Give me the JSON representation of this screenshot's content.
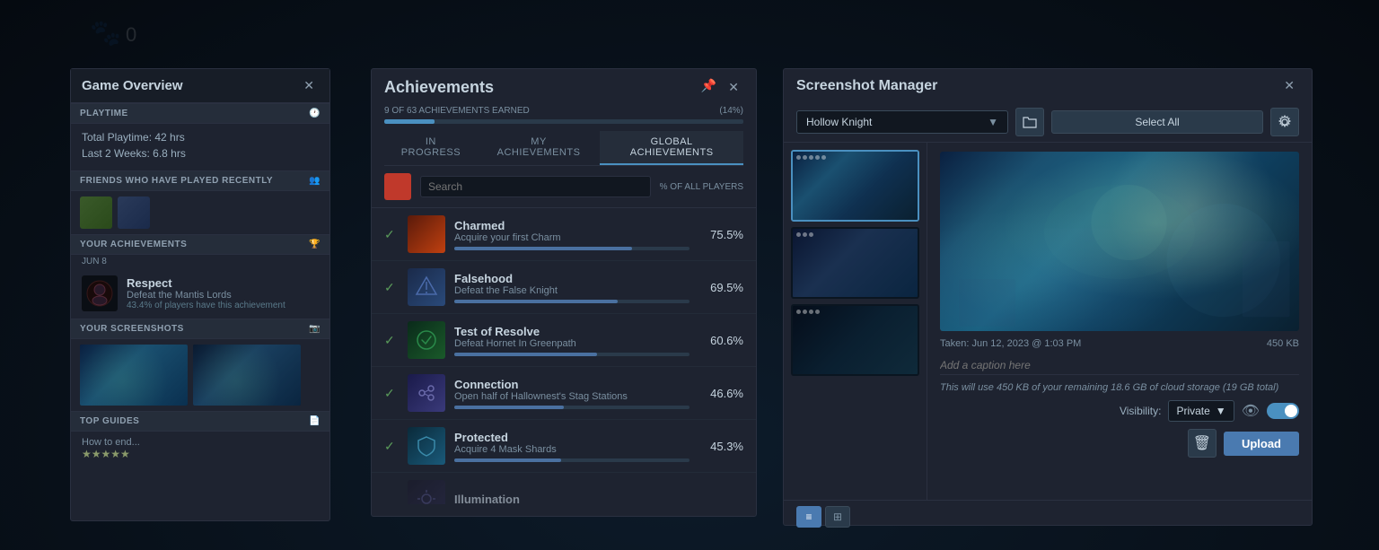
{
  "background": {
    "color": "#0a0e18"
  },
  "header": {
    "paw_icon": "🐾",
    "counter": "0"
  },
  "game_overview": {
    "title": "Game Overview",
    "sections": {
      "playtime": {
        "label": "PLAYTIME",
        "total": "Total Playtime: 42 hrs",
        "recent": "Last 2 Weeks: 6.8 hrs"
      },
      "friends": {
        "label": "FRIENDS WHO HAVE PLAYED RECENTLY"
      },
      "your_achievements": {
        "label": "YOUR ACHIEVEMENTS",
        "date": "JUN 8",
        "name": "Respect",
        "desc": "Defeat the Mantis Lords",
        "pct": "43.4% of players have this achievement"
      },
      "your_screenshots": {
        "label": "YOUR SCREENSHOTS"
      },
      "top_guides": {
        "label": "TOP GUIDES",
        "guide_text": "How to end..."
      }
    }
  },
  "achievements": {
    "title": "Achievements",
    "progress": {
      "label": "9 OF 63 ACHIEVEMENTS EARNED",
      "pct_label": "(14%)",
      "fill_pct": 14
    },
    "tabs": [
      {
        "id": "in-progress",
        "label": "IN PROGRESS"
      },
      {
        "id": "my-achievements",
        "label": "MY ACHIEVEMENTS"
      },
      {
        "id": "global-achievements",
        "label": "GLOBAL ACHIEVEMENTS",
        "active": true
      }
    ],
    "search_placeholder": "Search",
    "col_header": "% OF ALL PLAYERS",
    "items": [
      {
        "name": "Charmed",
        "desc": "Acquire your first Charm",
        "pct": "75.5%",
        "fill": 75.5,
        "checked": true,
        "color": "#a0502a"
      },
      {
        "name": "Falsehood",
        "desc": "Defeat the False Knight",
        "pct": "69.5%",
        "fill": 69.5,
        "checked": true,
        "color": "#4a6a8a"
      },
      {
        "name": "Test of Resolve",
        "desc": "Defeat Hornet In Greenpath",
        "pct": "60.6%",
        "fill": 60.6,
        "checked": true,
        "color": "#3a7a3a"
      },
      {
        "name": "Connection",
        "desc": "Open half of Hallownest's Stag Stations",
        "pct": "46.6%",
        "fill": 46.6,
        "checked": true,
        "color": "#5a5a8a"
      },
      {
        "name": "Protected",
        "desc": "Acquire 4 Mask Shards",
        "pct": "45.3%",
        "fill": 45.3,
        "checked": true,
        "color": "#3a6a8a"
      },
      {
        "name": "Illumination",
        "desc": "",
        "pct": "",
        "fill": 0,
        "checked": false,
        "color": "#4a4a6a"
      }
    ]
  },
  "screenshot_manager": {
    "title": "Screenshot Manager",
    "game_select": "Hollow Knight",
    "select_all_label": "Select All",
    "taken_label": "Taken: Jun 12, 2023 @ 1:03 PM",
    "size_label": "450 KB",
    "caption_placeholder": "Add a caption here",
    "storage_info": "This will use 450 KB of your remaining 18.6 GB of cloud storage (19 GB total)",
    "visibility_label": "Visibility:",
    "visibility_value": "Private",
    "upload_label": "Upload",
    "delete_icon": "🗑",
    "view_list_icon": "≡",
    "view_grid_icon": "⊞"
  }
}
